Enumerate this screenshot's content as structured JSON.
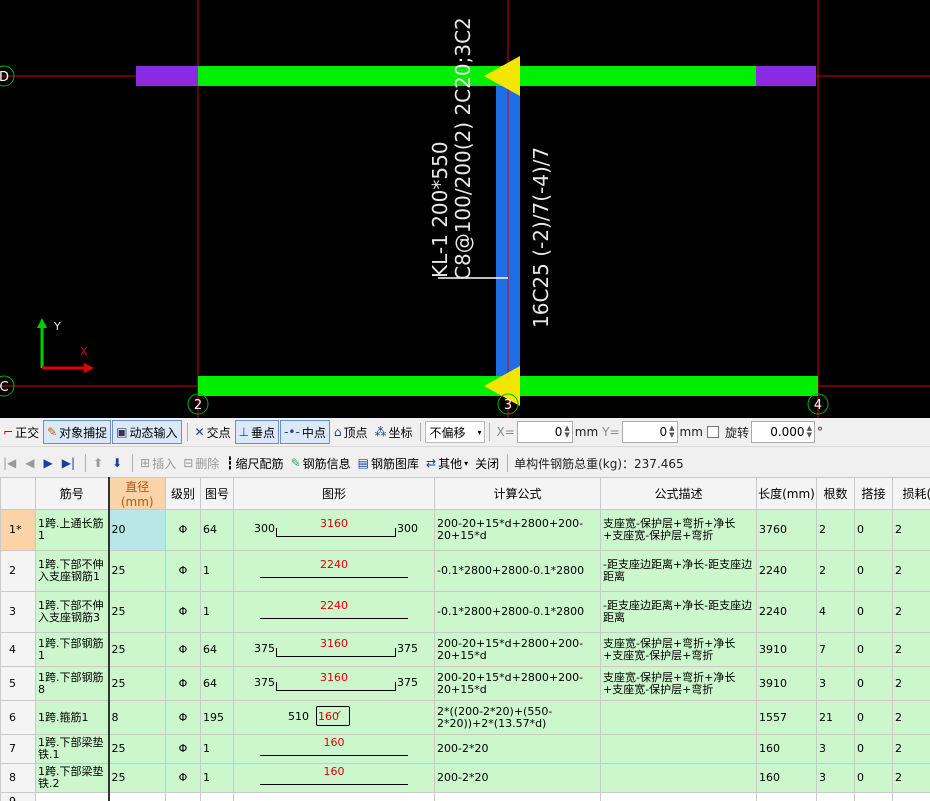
{
  "canvas": {
    "axis_labels": [
      "D",
      "C",
      "2",
      "3",
      "4"
    ],
    "beam_text_1": "KL-1 200*550",
    "beam_text_2": "C8@100/200(2) 2C20;3C2",
    "beam_text_3": "16C25 (-2)/7(-4)/7",
    "coord_x": "X",
    "coord_y": "Y"
  },
  "toolbar1": {
    "ortho": "正交",
    "snap": "对象捕捉",
    "dynamic": "动态输入",
    "intersect": "交点",
    "perp": "垂点",
    "mid": "中点",
    "vertex": "顶点",
    "coord": "坐标",
    "offset_value": "不偏移",
    "x_label": "X=",
    "x_value": "0",
    "mm1": "mm",
    "y_label": "Y=",
    "y_value": "0",
    "mm2": "mm",
    "rotate": "旋转",
    "rotate_value": "0.000",
    "degree": "°"
  },
  "toolbar2": {
    "insert": "插入",
    "delete": "删除",
    "scale": "缩尺配筋",
    "info": "钢筋信息",
    "library": "钢筋图库",
    "other": "其他",
    "close": "关闭",
    "total": "单构件钢筋总重(kg)：237.465"
  },
  "table": {
    "headers": [
      "",
      "筋号",
      "直径(mm)",
      "级别",
      "图号",
      "图形",
      "计算公式",
      "公式描述",
      "长度(mm)",
      "根数",
      "搭接",
      "损耗(%"
    ],
    "rows": [
      {
        "rn": "1*",
        "name": "1跨.上通长筋1",
        "dia": "20",
        "grade": "Φ",
        "fig": "64",
        "sl": "300",
        "sv": "3160",
        "sr": "300",
        "formula": "200-20+15*d+2800+200-20+15*d",
        "desc": "支座宽-保护层+弯折+净长+支座宽-保护层+弯折",
        "len": "3760",
        "count": "2",
        "lap": "0",
        "loss": "2"
      },
      {
        "rn": "2",
        "name": "1跨.下部不伸入支座钢筋1",
        "dia": "25",
        "grade": "Φ",
        "fig": "1",
        "sl": "",
        "sv": "2240",
        "sr": "",
        "formula": "-0.1*2800+2800-0.1*2800",
        "desc": "-距支座边距离+净长-距支座边距离",
        "len": "2240",
        "count": "2",
        "lap": "0",
        "loss": "2"
      },
      {
        "rn": "3",
        "name": "1跨.下部不伸入支座钢筋3",
        "dia": "25",
        "grade": "Φ",
        "fig": "1",
        "sl": "",
        "sv": "2240",
        "sr": "",
        "formula": "-0.1*2800+2800-0.1*2800",
        "desc": "-距支座边距离+净长-距支座边距离",
        "len": "2240",
        "count": "4",
        "lap": "0",
        "loss": "2"
      },
      {
        "rn": "4",
        "name": "1跨.下部钢筋1",
        "dia": "25",
        "grade": "Φ",
        "fig": "64",
        "sl": "375",
        "sv": "3160",
        "sr": "375",
        "formula": "200-20+15*d+2800+200-20+15*d",
        "desc": "支座宽-保护层+弯折+净长+支座宽-保护层+弯折",
        "len": "3910",
        "count": "7",
        "lap": "0",
        "loss": "2"
      },
      {
        "rn": "5",
        "name": "1跨.下部钢筋8",
        "dia": "25",
        "grade": "Φ",
        "fig": "64",
        "sl": "375",
        "sv": "3160",
        "sr": "375",
        "formula": "200-20+15*d+2800+200-20+15*d",
        "desc": "支座宽-保护层+弯折+净长+支座宽-保护层+弯折",
        "len": "3910",
        "count": "3",
        "lap": "0",
        "loss": "2"
      },
      {
        "rn": "6",
        "name": "1跨.箍筋1",
        "dia": "8",
        "grade": "Φ",
        "fig": "195",
        "sl": "510",
        "sv": "160",
        "sr": "",
        "formula": "2*((200-2*20)+(550-2*20))+2*(13.57*d)",
        "desc": "",
        "len": "1557",
        "count": "21",
        "lap": "0",
        "loss": "2"
      },
      {
        "rn": "7",
        "name": "1跨.下部梁垫铁.1",
        "dia": "25",
        "grade": "Φ",
        "fig": "1",
        "sl": "",
        "sv": "160",
        "sr": "",
        "formula": "200-2*20",
        "desc": "",
        "len": "160",
        "count": "3",
        "lap": "0",
        "loss": "2"
      },
      {
        "rn": "8",
        "name": "1跨.下部梁垫铁.2",
        "dia": "25",
        "grade": "Φ",
        "fig": "1",
        "sl": "",
        "sv": "160",
        "sr": "",
        "formula": "200-2*20",
        "desc": "",
        "len": "160",
        "count": "3",
        "lap": "0",
        "loss": "2"
      },
      {
        "rn": "9",
        "name": "",
        "dia": "",
        "grade": "",
        "fig": "",
        "sl": "",
        "sv": "",
        "sr": "",
        "formula": "",
        "desc": "",
        "len": "",
        "count": "",
        "lap": "",
        "loss": ""
      }
    ]
  },
  "colors": {
    "beam_green": "#00ee00",
    "beam_purple": "#8a2be2",
    "rebar_blue": "#1e6fe6",
    "support_yellow": "#f2e600",
    "axis_red": "#d40000"
  }
}
